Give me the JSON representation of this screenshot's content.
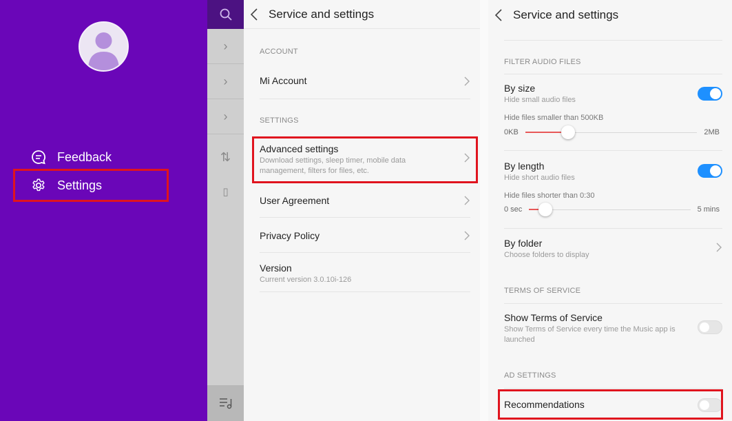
{
  "drawer": {
    "items": [
      {
        "label": "Feedback",
        "icon": "feedback-icon"
      },
      {
        "label": "Settings",
        "icon": "gear-icon"
      }
    ]
  },
  "middle": {
    "title": "Service and settings",
    "section_account": "ACCOUNT",
    "mi_account": "Mi Account",
    "section_settings": "SETTINGS",
    "advanced_title": "Advanced settings",
    "advanced_sub": "Download settings, sleep timer, mobile data management, filters for files, etc.",
    "user_agreement": "User Agreement",
    "privacy_policy": "Privacy Policy",
    "version_title": "Version",
    "version_sub": "Current version 3.0.10i-126"
  },
  "right": {
    "title": "Service and settings",
    "section_filter": "FILTER AUDIO FILES",
    "by_size_title": "By size",
    "by_size_sub": "Hide small audio files",
    "by_size_on": true,
    "size_caption": "Hide files smaller than 500KB",
    "size_min": "0KB",
    "size_max": "2MB",
    "size_fraction": 0.25,
    "by_length_title": "By length",
    "by_length_sub": "Hide short audio files",
    "by_length_on": true,
    "length_caption": "Hide files shorter than 0:30",
    "length_min": "0 sec",
    "length_max": "5 mins",
    "length_fraction": 0.1,
    "by_folder_title": "By folder",
    "by_folder_sub": "Choose folders to display",
    "section_terms": "TERMS OF SERVICE",
    "terms_title": "Show Terms of Service",
    "terms_sub": "Show Terms of Service every time the Music app is launched",
    "terms_on": false,
    "section_ad": "AD SETTINGS",
    "recommendations": "Recommendations",
    "recommendations_on": false
  },
  "colors": {
    "drawer": "#6a06b8",
    "highlight": "#e0141e",
    "toggle_on": "#1e90ff",
    "slider_fill": "#e85858"
  }
}
